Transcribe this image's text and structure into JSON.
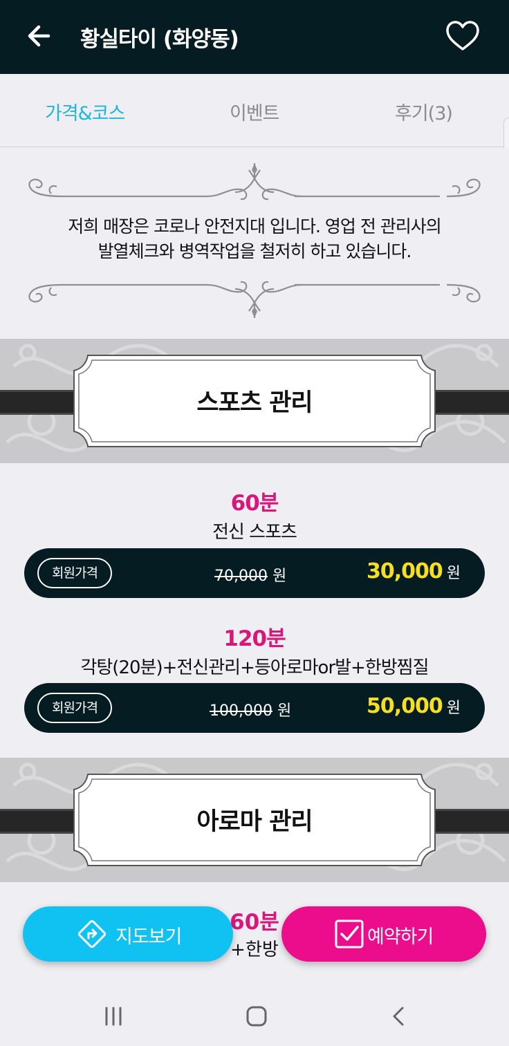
{
  "header": {
    "title": "황실타이 (화양동)",
    "back_icon": "arrow-left-icon",
    "favorite_icon": "heart-icon"
  },
  "tabs": [
    {
      "label": "가격&코스",
      "active": true
    },
    {
      "label": "이벤트",
      "active": false
    },
    {
      "label": "후기(3)",
      "active": false
    }
  ],
  "notice": {
    "line1": "저희 매장은 코로나 안전지대 입니다. 영업 전 관리사의",
    "line2": "발열체크와 병역작업을 철저히 하고 있습니다."
  },
  "sections": [
    {
      "title": "스포츠 관리",
      "courses": [
        {
          "duration": "60분",
          "description": "전신 스포츠",
          "badge": "회원가격",
          "original_price": "70,000",
          "price": "30,000",
          "unit": "원"
        },
        {
          "duration": "120분",
          "description": "각탕(20분)+전신관리+등아로마or발+한방찜질",
          "badge": "회원가격",
          "original_price": "100,000",
          "price": "50,000",
          "unit": "원"
        }
      ]
    },
    {
      "title": "아로마 관리",
      "courses": [
        {
          "duration": "60분",
          "description": "+한방"
        }
      ]
    }
  ],
  "actions": {
    "map_label": "지도보기",
    "map_icon": "directions-icon",
    "book_label": "예약하기",
    "book_icon": "checkbox-icon"
  },
  "colors": {
    "header_bg": "#061c23",
    "active_tab": "#1db6dd",
    "duration": "#d9177b",
    "price": "#f7df1f",
    "map_button": "#10c2f2",
    "book_button": "#ec0d8c"
  },
  "system_nav": [
    "recent-apps-icon",
    "home-icon",
    "back-icon"
  ]
}
